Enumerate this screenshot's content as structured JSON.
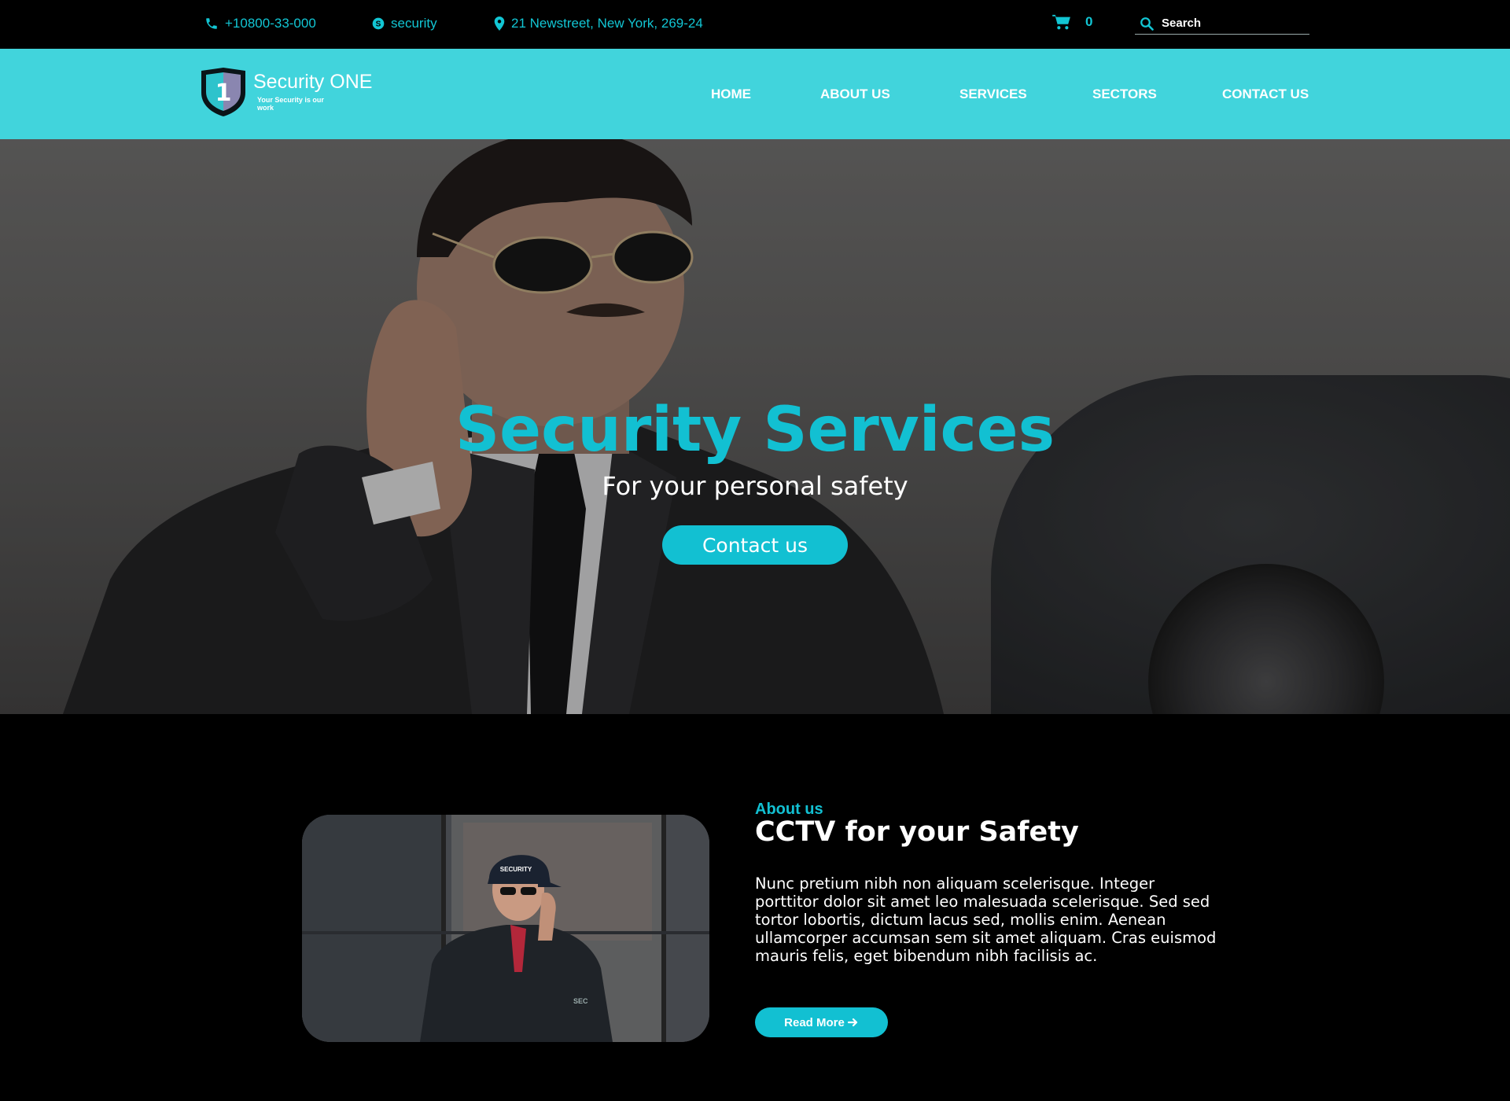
{
  "topbar": {
    "phone": "+10800-33-000",
    "skype": "security",
    "address": "21 Newstreet, New York, 269-24",
    "cart_count": "0",
    "search_placeholder": "Search"
  },
  "logo": {
    "badge_number": "1",
    "brand": "Security ONE",
    "tagline": "Your Security is our work"
  },
  "nav": {
    "items": [
      {
        "label": "HOME"
      },
      {
        "label": "ABOUT US"
      },
      {
        "label": "SERVICES"
      },
      {
        "label": "SECTORS"
      },
      {
        "label": "CONTACT US"
      }
    ]
  },
  "hero": {
    "title": "Security Services",
    "subtitle": "For your personal safety",
    "cta_label": "Contact us"
  },
  "about": {
    "kicker": "About us",
    "title": "CCTV for your Safety",
    "body": "Nunc pretium nibh non aliquam scelerisque. Integer porttitor dolor sit amet leo malesuada scelerisque. Sed sed tortor lobortis, dictum lacus sed, mollis enim. Aenean ullamcorper accumsan sem sit amet aliquam. Cras euismod mauris felis, eget bibendum nibh facilisis ac.",
    "read_more_label": "Read More",
    "cap_text": "SECURITY",
    "jacket_text": "SEC"
  },
  "colors": {
    "accent": "#12c0d2",
    "navbar": "#41d4dc",
    "background": "#000000"
  },
  "icons": {
    "phone": "phone-icon",
    "skype": "skype-icon",
    "address": "map-marker-icon",
    "cart": "shopping-cart-icon",
    "search": "search-icon",
    "read_more": "arrow-right-icon"
  }
}
